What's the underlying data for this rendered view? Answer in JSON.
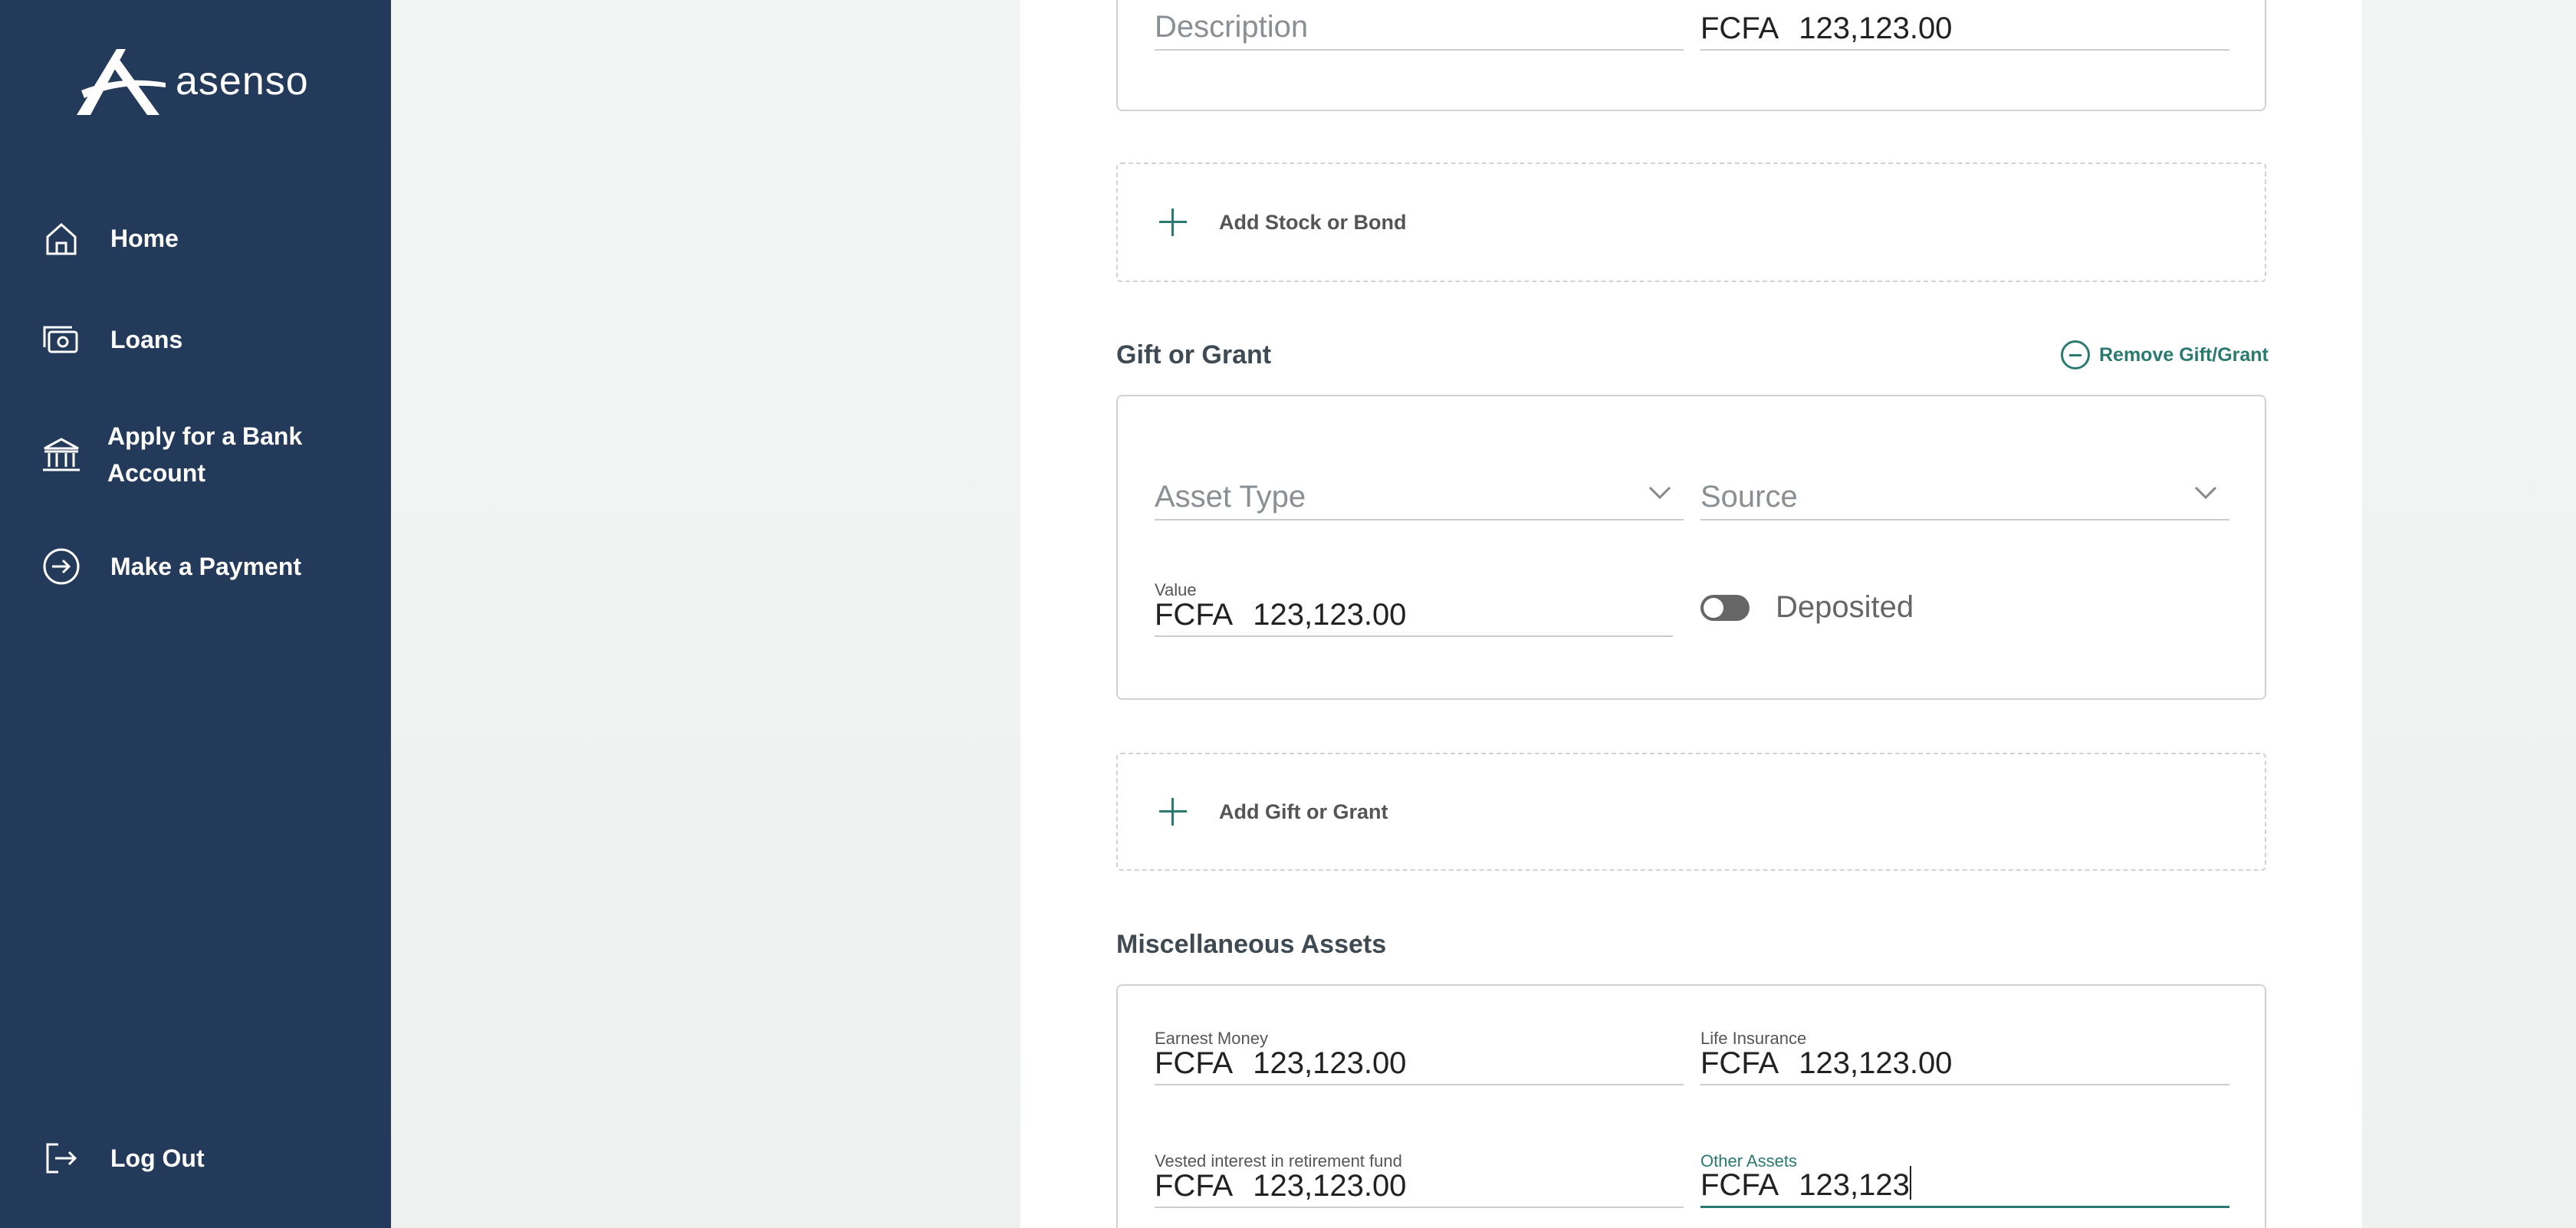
{
  "brand": {
    "name": "asenso"
  },
  "sidebar": {
    "items": [
      {
        "label": "Home",
        "icon": "home-icon"
      },
      {
        "label": "Loans",
        "icon": "cash-icon"
      },
      {
        "label": "Apply for a Bank Account",
        "icon": "bank-icon"
      },
      {
        "label": "Make a Payment",
        "icon": "arrow-circle-icon"
      }
    ],
    "logout": {
      "label": "Log Out",
      "icon": "logout-icon"
    }
  },
  "colors": {
    "sidebar_bg": "#243a5a",
    "accent": "#2a7a70",
    "page_bg": "#f1f3f3"
  },
  "top_card": {
    "description_placeholder": "Description",
    "currency": "FCFA",
    "value": "123,123.00"
  },
  "add_stock": {
    "label": "Add Stock or Bond"
  },
  "gift": {
    "title": "Gift or Grant",
    "remove_label": "Remove Gift/Grant",
    "asset_type_placeholder": "Asset Type",
    "source_placeholder": "Source",
    "value_caption": "Value",
    "currency": "FCFA",
    "value": "123,123.00",
    "deposited_label": "Deposited",
    "deposited_on": false
  },
  "add_gift": {
    "label": "Add Gift or Grant"
  },
  "misc": {
    "title": "Miscellaneous Assets",
    "fields": [
      {
        "caption": "Earnest Money",
        "currency": "FCFA",
        "value": "123,123.00"
      },
      {
        "caption": "Life Insurance",
        "currency": "FCFA",
        "value": "123,123.00"
      },
      {
        "caption": "Vested interest in retirement fund",
        "currency": "FCFA",
        "value": "123,123.00"
      },
      {
        "caption": "Other Assets",
        "currency": "FCFA",
        "value": "123,123"
      }
    ]
  }
}
